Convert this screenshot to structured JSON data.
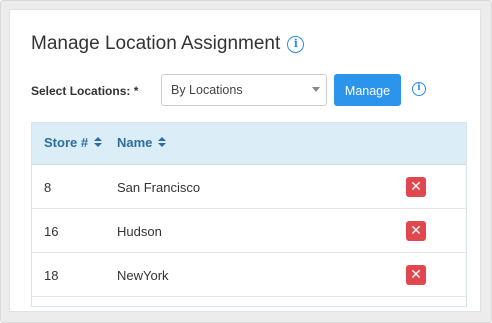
{
  "panel": {
    "title": "Manage Location Assignment",
    "title_info_icon": "info-icon"
  },
  "selector": {
    "label": "Select Locations: *",
    "selected_value": "By Locations",
    "manage_label": "Manage",
    "info_icon": "info-icon"
  },
  "table": {
    "headers": [
      "Store #",
      "Name"
    ],
    "rows": [
      {
        "store": "8",
        "name": "San Francisco"
      },
      {
        "store": "16",
        "name": "Hudson"
      },
      {
        "store": "18",
        "name": "NewYork"
      }
    ],
    "delete_icon": "close-icon"
  },
  "colors": {
    "accent": "#2b95eb",
    "header_bg": "#dbeef8",
    "header_text": "#2b6e9c",
    "delete": "#e0474f"
  }
}
